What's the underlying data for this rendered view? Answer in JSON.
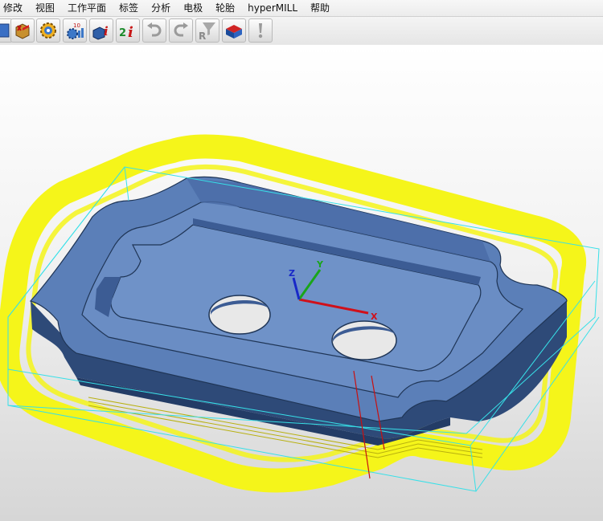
{
  "menubar": {
    "items": [
      "修改",
      "视图",
      "工作平面",
      "标签",
      "分析",
      "电极",
      "轮胎",
      "hyperMILL",
      "帮助"
    ]
  },
  "toolbar": {
    "buttons": [
      {
        "name": "model-icon"
      },
      {
        "name": "package-icon"
      },
      {
        "name": "gear-icon"
      },
      {
        "name": "gear-chart-icon"
      },
      {
        "name": "info-cube-icon"
      },
      {
        "name": "info-two-icon"
      },
      {
        "name": "undo-icon"
      },
      {
        "name": "redo-icon"
      },
      {
        "name": "filter-r-icon"
      },
      {
        "name": "stock-block-icon"
      },
      {
        "name": "warning-icon"
      }
    ]
  },
  "axes": {
    "x_label": "X",
    "y_label": "Y",
    "z_label": "Z",
    "x_color": "#d0101a",
    "y_color": "#1aa51a",
    "z_color": "#1828c8"
  },
  "colors": {
    "part": "#5b7fb8",
    "toolpath": "#f5f51a",
    "bounding_box": "#37e0e8"
  }
}
